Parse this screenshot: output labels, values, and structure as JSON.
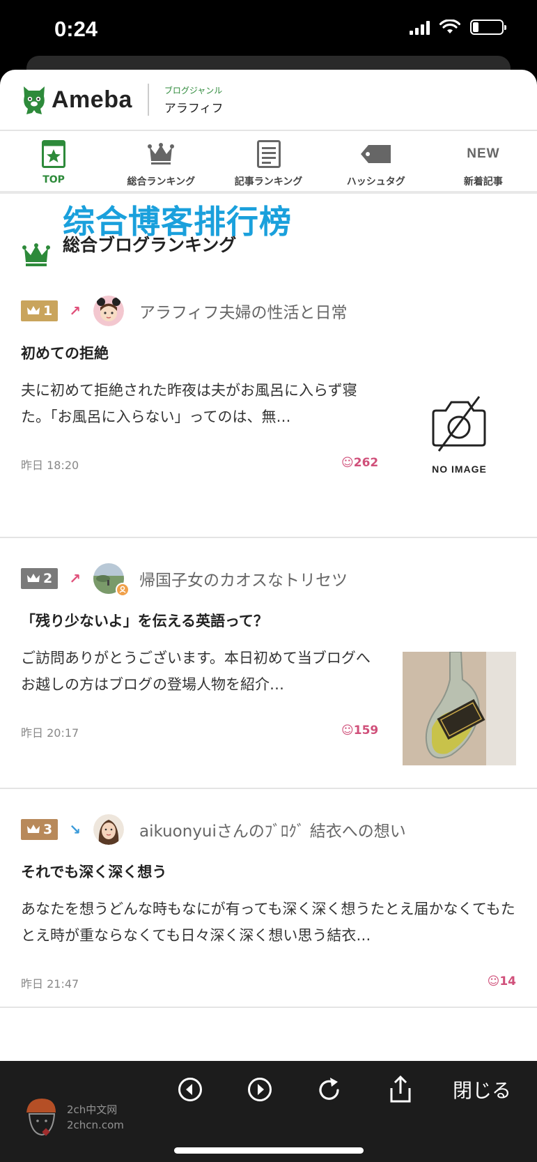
{
  "status_bar": {
    "time": "0:24",
    "signal_icon": "cellular-signal-icon",
    "wifi_icon": "wifi-icon",
    "battery_level": 0.2
  },
  "header": {
    "logo_text": "Ameba",
    "genre_caption": "ブログジャンル",
    "genre_name": "アラフィフ"
  },
  "nav": {
    "items": [
      {
        "label": "TOP",
        "icon": "top-page-icon",
        "active": true
      },
      {
        "label": "総合ランキング",
        "icon": "crown-icon",
        "active": false
      },
      {
        "label": "記事ランキング",
        "icon": "article-icon",
        "active": false
      },
      {
        "label": "ハッシュタグ",
        "icon": "tag-icon",
        "active": false
      },
      {
        "label": "新着記事",
        "icon": "new-icon",
        "active": false
      }
    ],
    "new_icon_text": "NEW"
  },
  "overlay_caption": "综合博客排行榜",
  "section": {
    "title": "総合ブログランキング"
  },
  "entries": [
    {
      "rank": "1",
      "rank_color": "#c9a45c",
      "trend": "up",
      "trend_symbol": "↗",
      "trend_color": "#e0507a",
      "blog_name": "アラフィフ夫婦の性活と日常",
      "title": "初めての拒絶",
      "excerpt": "夫に初めて拒絶された昨夜は夫がお風呂に入らず寝た。「お風呂に入らない」ってのは、無…",
      "time": "昨日 18:20",
      "likes": "262",
      "thumb_label": "NO IMAGE"
    },
    {
      "rank": "2",
      "rank_color": "#7a7a7a",
      "trend": "up",
      "trend_symbol": "↗",
      "trend_color": "#e0507a",
      "blog_name": "帰国子女のカオスなトリセツ",
      "title": "「残り少ないよ」を伝える英語って？",
      "excerpt": "ご訪問ありがとうございます。本日初めて当ブログへお越しの方はブログの登場人物を紹介…",
      "time": "昨日 20:17",
      "likes": "159"
    },
    {
      "rank": "3",
      "rank_color": "#b8895a",
      "trend": "down",
      "trend_symbol": "↘",
      "trend_color": "#3a9ad9",
      "blog_name": "aikuonyuiさんのﾌﾞﾛｸﾞ 結衣への想い",
      "title": "それでも深く深く想う",
      "excerpt": "あなたを想うどんな時もなにが有っても深く深く想うたとえ届かなくてもたとえ時が重ならなくても日々深く深く想い思う結衣…",
      "time": "昨日 21:47",
      "likes": "14"
    }
  ],
  "bottom_bar": {
    "back_icon": "back-arrow-icon",
    "forward_icon": "forward-arrow-icon",
    "reload_icon": "reload-icon",
    "share_icon": "share-icon",
    "close_label": "閉じる"
  },
  "watermark": {
    "line1": "2ch中文网",
    "line2": "2chcn.com"
  }
}
